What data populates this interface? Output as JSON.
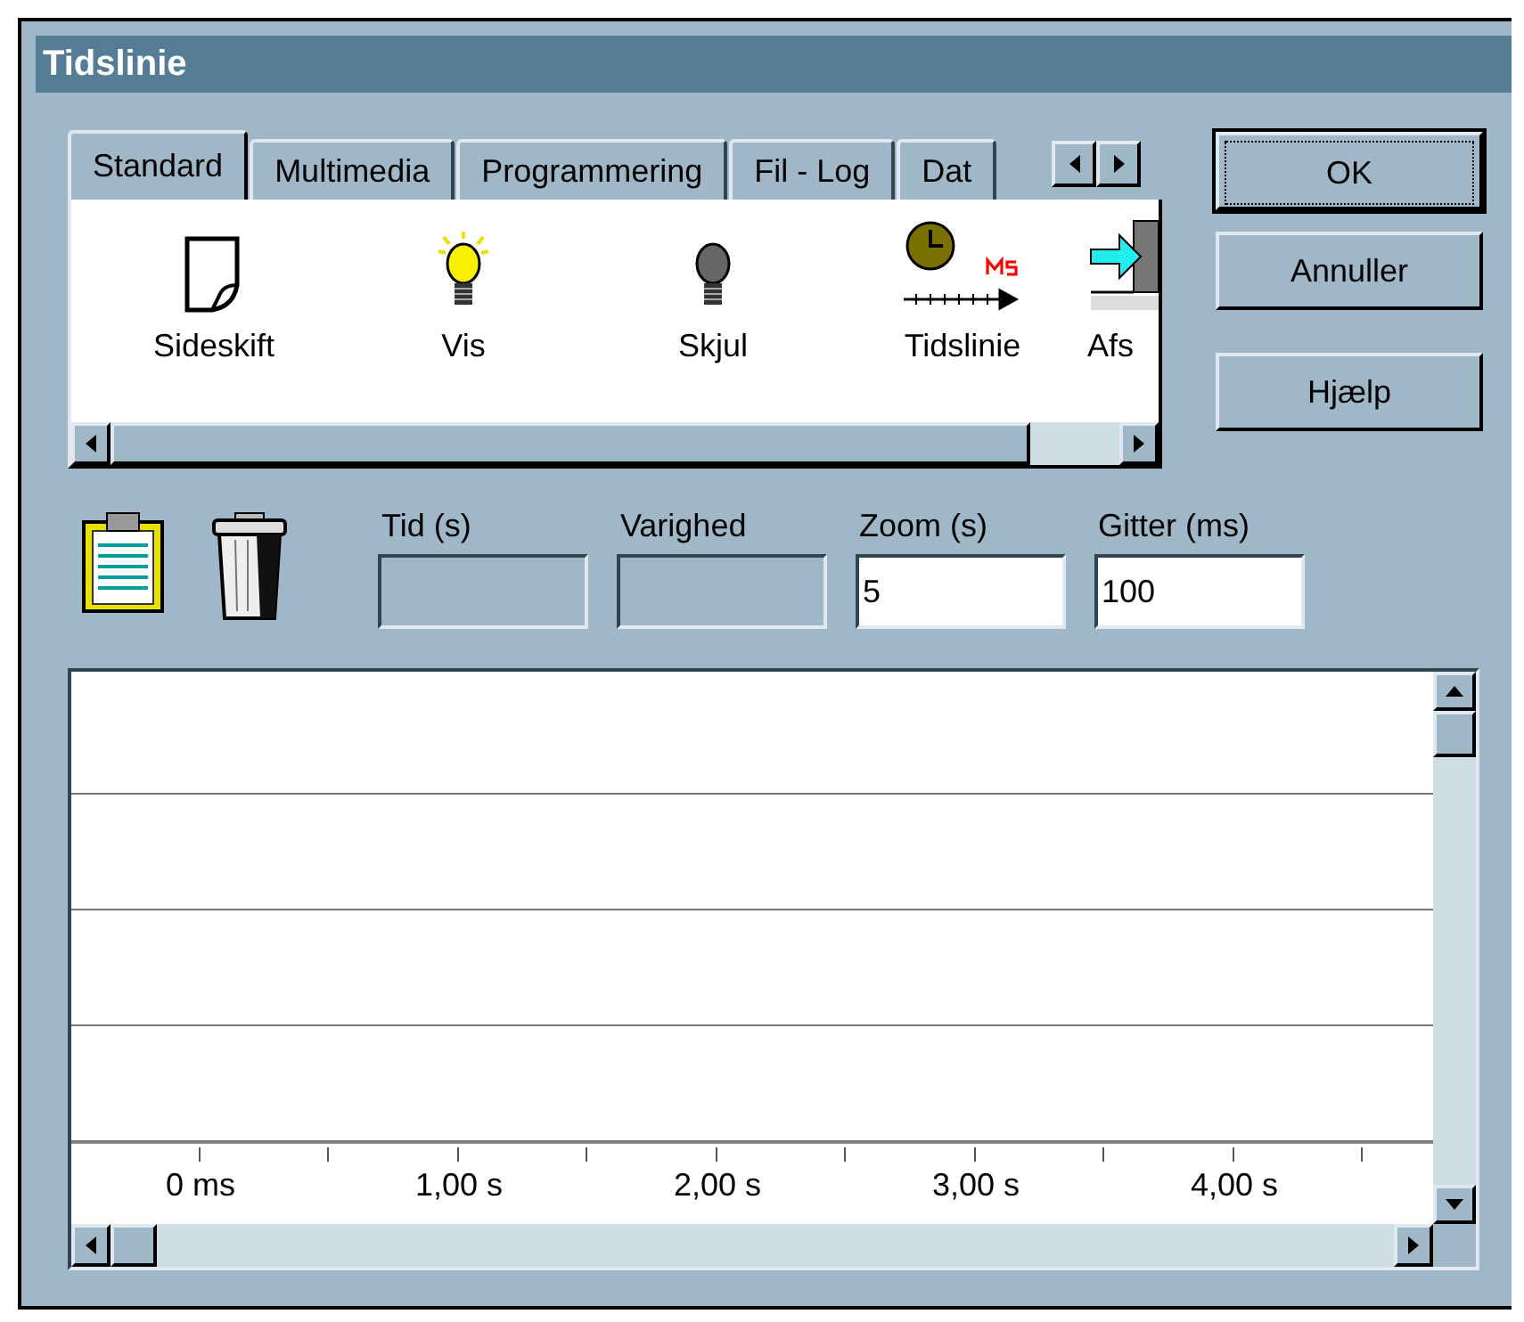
{
  "window": {
    "title": "Tidslinie"
  },
  "tabs": [
    {
      "label": "Standard",
      "selected": true
    },
    {
      "label": "Multimedia",
      "selected": false
    },
    {
      "label": "Programmering",
      "selected": false
    },
    {
      "label": "Fil - Log",
      "selected": false
    },
    {
      "label": "Dat",
      "selected": false
    }
  ],
  "palette_items": [
    {
      "label": "Sideskift",
      "kind": "page"
    },
    {
      "label": "Vis",
      "kind": "bulb-on"
    },
    {
      "label": "Skjul",
      "kind": "bulb-off"
    },
    {
      "label": "Tidslinie",
      "kind": "timeline"
    },
    {
      "label": "Afs",
      "kind": "exit"
    }
  ],
  "buttons": [
    {
      "label": "OK",
      "default": true
    },
    {
      "label": "Annuller",
      "default": false
    },
    {
      "label": "Hjælp",
      "default": false
    }
  ],
  "fields": [
    {
      "label": "Tid (s)",
      "disabled": true
    },
    {
      "label": "Varighed",
      "disabled": true
    },
    {
      "label": "Zoom (s)",
      "value": "5",
      "disabled": false
    },
    {
      "label": "Gitter (ms)",
      "value": "100",
      "disabled": false
    }
  ],
  "ruler": {
    "labels": [
      "0 ms",
      "1,00 s",
      "2,00 s",
      "3,00 s",
      "4,00 s"
    ]
  }
}
